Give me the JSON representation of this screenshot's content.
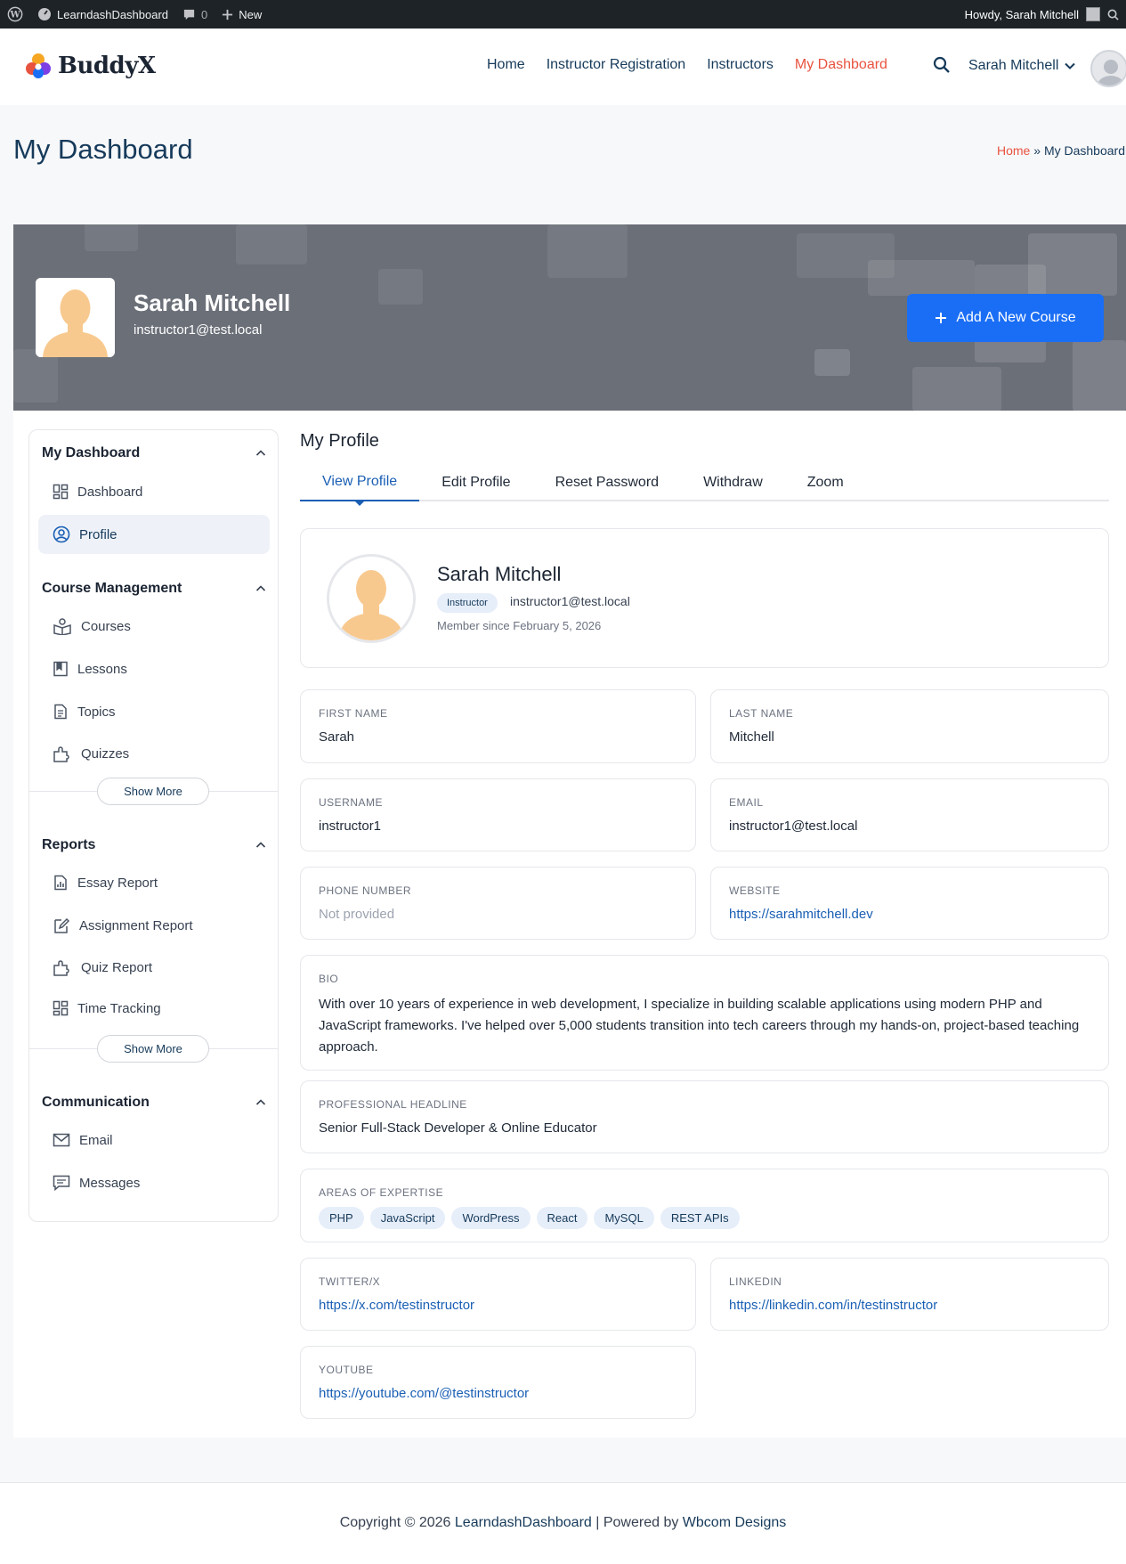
{
  "admin_bar": {
    "site_name": "LearndashDashboard",
    "comments_count": "0",
    "new_label": "New",
    "howdy": "Howdy, Sarah Mitchell"
  },
  "header": {
    "logo_text": "BuddyX",
    "nav": [
      {
        "label": "Home"
      },
      {
        "label": "Instructor Registration"
      },
      {
        "label": "Instructors"
      },
      {
        "label": "My Dashboard"
      }
    ],
    "user_name": "Sarah Mitchell",
    "accent_color": "#e8533f"
  },
  "title_bar": {
    "title": "My Dashboard",
    "breadcrumb_home": "Home",
    "breadcrumb_sep": "»",
    "breadcrumb_current": "My Dashboard"
  },
  "banner": {
    "name": "Sarah Mitchell",
    "email": "instructor1@test.local",
    "add_course_label": "Add A New Course",
    "button_color": "#1a6ef5"
  },
  "sidebar": {
    "sections": [
      {
        "title": "My Dashboard",
        "items": [
          {
            "label": "Dashboard",
            "icon": "grid-icon"
          },
          {
            "label": "Profile",
            "icon": "user-circle-icon"
          }
        ]
      },
      {
        "title": "Course Management",
        "items": [
          {
            "label": "Courses",
            "icon": "courses-icon"
          },
          {
            "label": "Lessons",
            "icon": "bookmark-icon"
          },
          {
            "label": "Topics",
            "icon": "document-icon"
          },
          {
            "label": "Quizzes",
            "icon": "puzzle-icon"
          }
        ],
        "show_more": "Show More"
      },
      {
        "title": "Reports",
        "items": [
          {
            "label": "Essay Report",
            "icon": "chart-icon"
          },
          {
            "label": "Assignment Report",
            "icon": "edit-icon"
          },
          {
            "label": "Quiz Report",
            "icon": "puzzle-icon"
          },
          {
            "label": "Time Tracking",
            "icon": "grid-icon"
          }
        ],
        "show_more": "Show More"
      },
      {
        "title": "Communication",
        "items": [
          {
            "label": "Email",
            "icon": "mail-icon"
          },
          {
            "label": "Messages",
            "icon": "message-icon"
          }
        ]
      }
    ]
  },
  "content": {
    "title": "My Profile",
    "tabs": [
      {
        "label": "View Profile"
      },
      {
        "label": "Edit Profile"
      },
      {
        "label": "Reset Password"
      },
      {
        "label": "Withdraw"
      },
      {
        "label": "Zoom"
      }
    ],
    "profile": {
      "name": "Sarah Mitchell",
      "role": "Instructor",
      "email": "instructor1@test.local",
      "member_since": "Member since February 5, 2026"
    },
    "fields": {
      "first_name": {
        "label": "FIRST NAME",
        "value": "Sarah"
      },
      "last_name": {
        "label": "LAST NAME",
        "value": "Mitchell"
      },
      "username": {
        "label": "USERNAME",
        "value": "instructor1"
      },
      "email": {
        "label": "EMAIL",
        "value": "instructor1@test.local"
      },
      "phone": {
        "label": "PHONE NUMBER",
        "value": "Not provided"
      },
      "website": {
        "label": "WEBSITE",
        "value": "https://sarahmitchell.dev"
      },
      "bio": {
        "label": "BIO",
        "value": "With over 10 years of experience in web development, I specialize in building scalable applications using modern PHP and JavaScript frameworks. I've helped over 5,000 students transition into tech careers through my hands-on, project-based teaching approach."
      },
      "headline": {
        "label": "PROFESSIONAL HEADLINE",
        "value": "Senior Full-Stack Developer & Online Educator"
      },
      "expertise": {
        "label": "AREAS OF EXPERTISE",
        "tags": [
          "PHP",
          "JavaScript",
          "WordPress",
          "React",
          "MySQL",
          "REST APIs"
        ]
      },
      "twitter": {
        "label": "TWITTER/X",
        "value": "https://x.com/testinstructor"
      },
      "linkedin": {
        "label": "LINKEDIN",
        "value": "https://linkedin.com/in/testinstructor"
      },
      "youtube": {
        "label": "YOUTUBE",
        "value": "https://youtube.com/@testinstructor"
      }
    }
  },
  "footer": {
    "prefix": "Copyright © 2026",
    "site_link": "LearndashDashboard",
    "middle": "| Powered by",
    "powered_link": "Wbcom Designs"
  }
}
